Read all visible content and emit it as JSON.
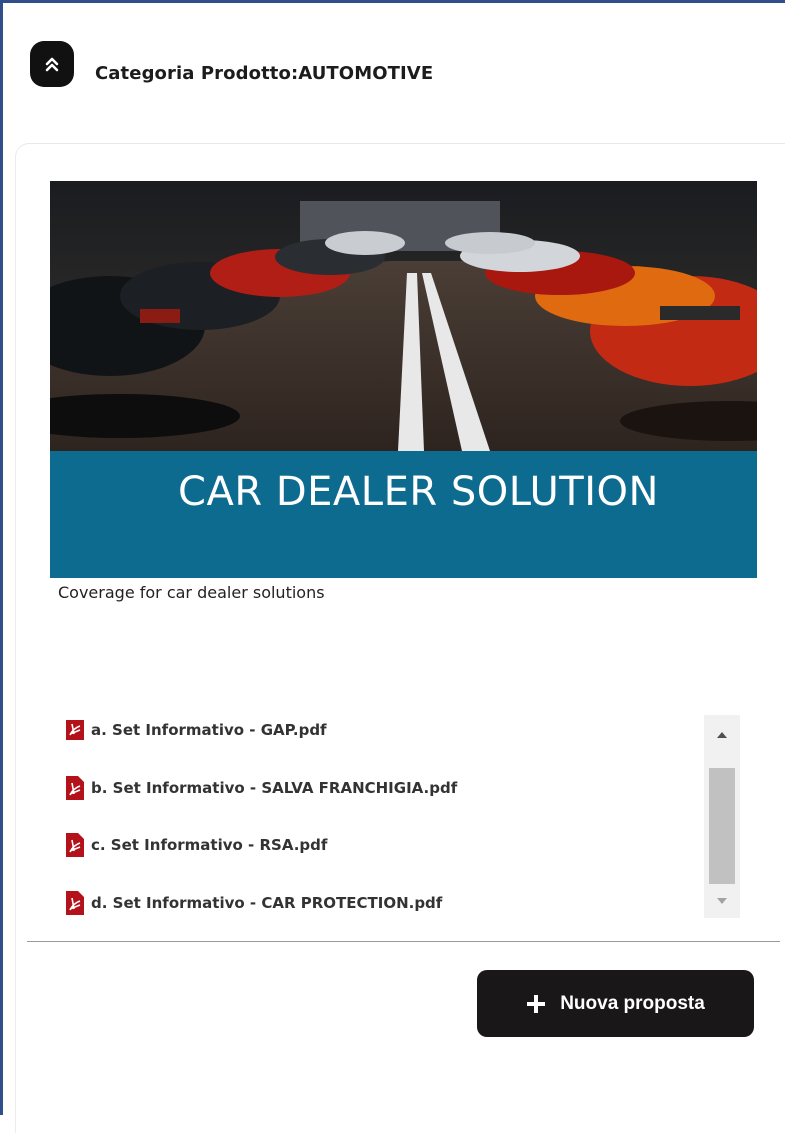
{
  "header": {
    "title": "Categoria Prodotto:AUTOMOTIVE",
    "toggle_icon": "double-chevron-up-icon"
  },
  "product": {
    "banner_title": "CAR DEALER SOLUTION",
    "banner_color": "#0d6b8f",
    "description": "Coverage for car dealer solutions"
  },
  "documents": [
    {
      "label": "a. Set Informativo - GAP.pdf",
      "icon": "pdf-icon"
    },
    {
      "label": "b. Set Informativo - SALVA FRANCHIGIA.pdf",
      "icon": "pdf-icon"
    },
    {
      "label": "c. Set Informativo - RSA.pdf",
      "icon": "pdf-icon"
    },
    {
      "label": "d. Set Informativo - CAR PROTECTION.pdf",
      "icon": "pdf-icon"
    }
  ],
  "actions": {
    "new_proposal_label": "Nuova proposta",
    "new_proposal_icon": "plus-icon"
  },
  "colors": {
    "frame_border": "#2f4f8a",
    "button_bg": "#1a1718",
    "pdf_red": "#b3121b"
  }
}
